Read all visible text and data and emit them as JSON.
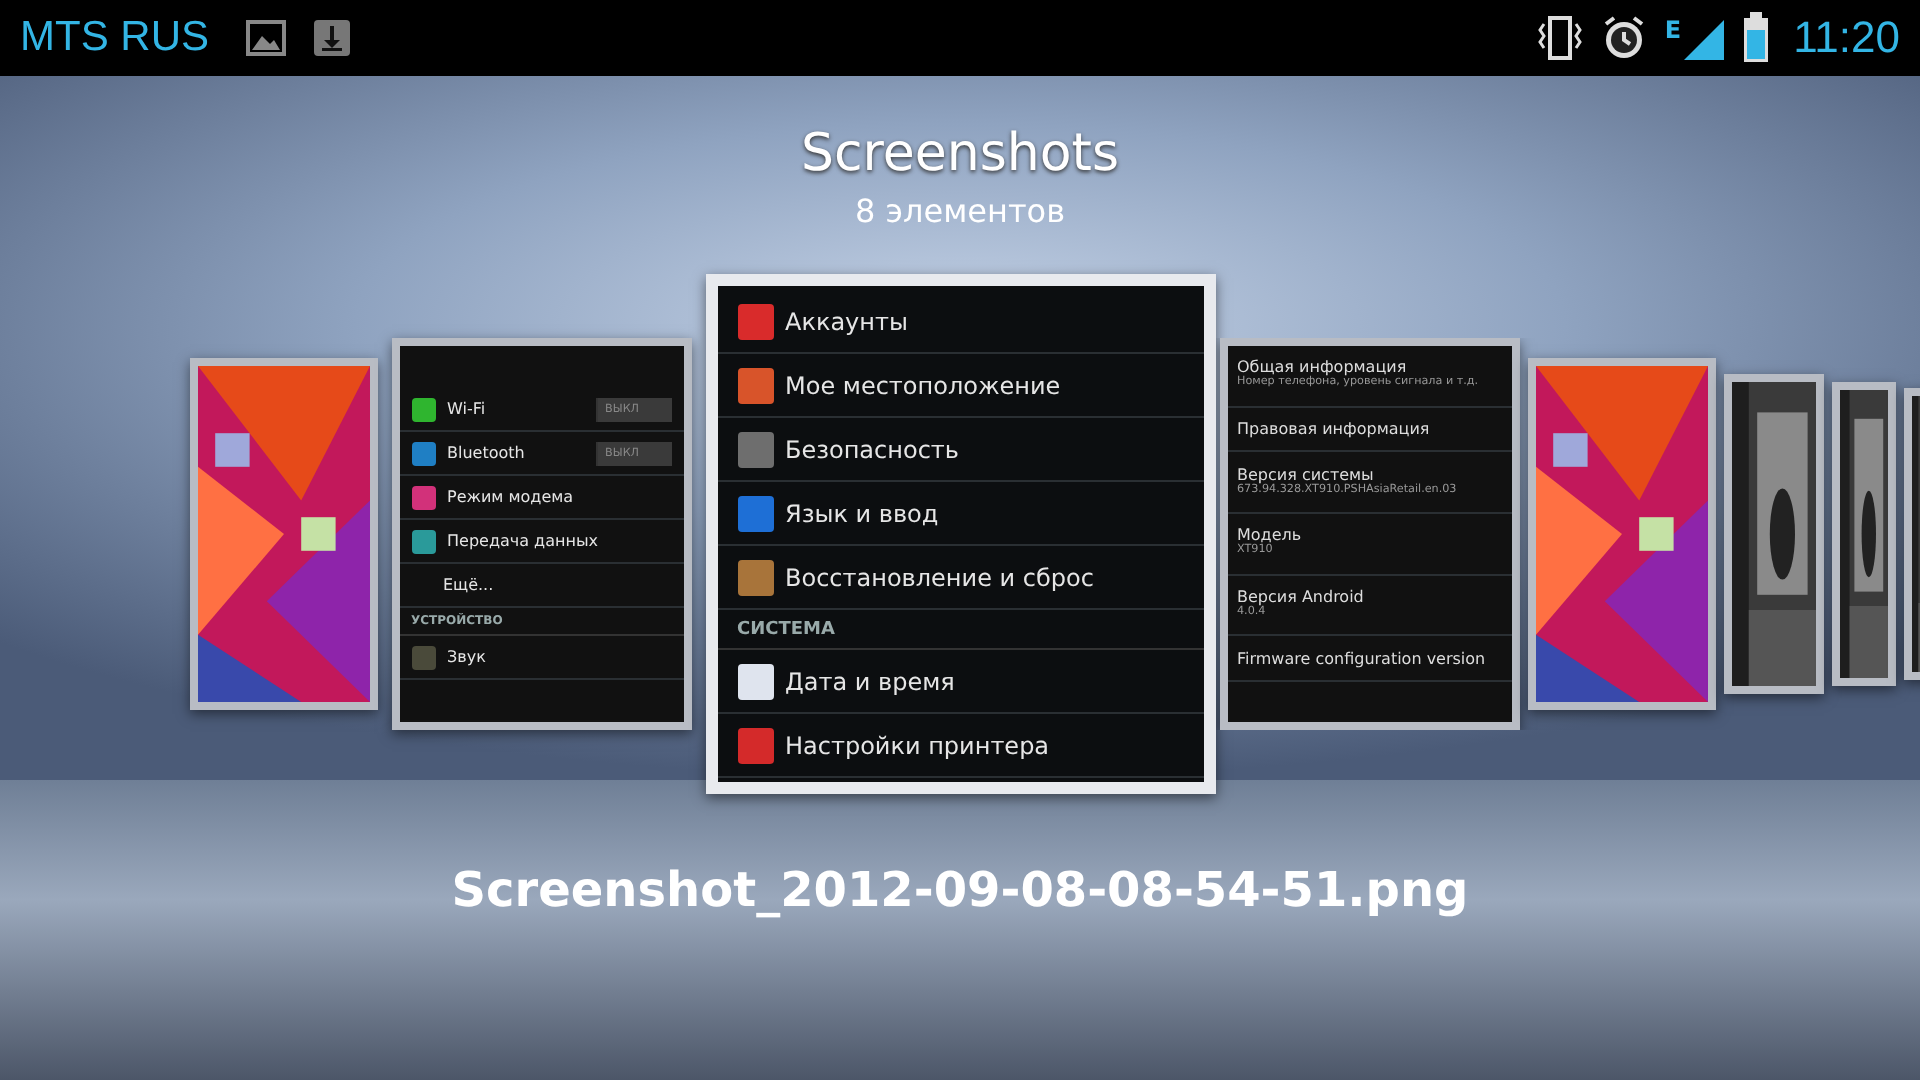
{
  "status_bar": {
    "carrier": "MTS RUS",
    "network_type": "E",
    "time": "11:20"
  },
  "album": {
    "title": "Screenshots",
    "count": "8 элементов"
  },
  "thumbnails": [
    {
      "kind": "picture",
      "selected": false
    },
    {
      "kind": "settings",
      "selected": false,
      "rows": [
        {
          "kind": "toggle",
          "label": "Wi-Fi",
          "value": "ВЫКЛ",
          "color": "#2fb52f"
        },
        {
          "kind": "toggle",
          "label": "Bluetooth",
          "value": "ВЫКЛ",
          "color": "#1f7fc4"
        },
        {
          "kind": "item",
          "label": "Режим модема",
          "color": "#d2317a"
        },
        {
          "kind": "item",
          "label": "Передача данных",
          "color": "#2a9a9a"
        },
        {
          "kind": "plain",
          "label": "Ещё..."
        },
        {
          "kind": "header",
          "label": "УСТРОЙСТВО"
        },
        {
          "kind": "item",
          "label": "Звук",
          "color": "#4a4a3a"
        }
      ]
    },
    {
      "kind": "settings",
      "selected": true,
      "rows": [
        {
          "kind": "item",
          "label": "Аккаунты",
          "color": "#d92b2b"
        },
        {
          "kind": "item",
          "label": "Мое местоположение",
          "color": "#d8542a"
        },
        {
          "kind": "item",
          "label": "Безопасность",
          "color": "#6e6e6e"
        },
        {
          "kind": "item",
          "label": "Язык и ввод",
          "color": "#1e6fd6"
        },
        {
          "kind": "item",
          "label": "Восстановление и сброс",
          "color": "#a8743a"
        },
        {
          "kind": "header",
          "label": "СИСТЕМА"
        },
        {
          "kind": "item",
          "label": "Дата и время",
          "color": "#dfe4ee"
        },
        {
          "kind": "item",
          "label": "Настройки принтера",
          "color": "#d42a2a"
        }
      ]
    },
    {
      "kind": "info",
      "selected": false,
      "rows": [
        {
          "title": "Общая информация",
          "subtitle": "Номер телефона, уровень сигнала и т.д."
        },
        {
          "title": "Правовая информация"
        },
        {
          "title": "Версия системы",
          "subtitle": "673.94.328.XT910.PSHAsiaRetail.en.03"
        },
        {
          "title": "Модель",
          "subtitle": "XT910"
        },
        {
          "title": "Версия Android",
          "subtitle": "4.0.4"
        },
        {
          "title": "Firmware configuration version"
        }
      ]
    },
    {
      "kind": "picture",
      "selected": false
    },
    {
      "kind": "picture",
      "selected": false
    },
    {
      "kind": "picture",
      "selected": false
    },
    {
      "kind": "picture",
      "selected": false
    }
  ],
  "filename": "Screenshot_2012-09-08-08-54-51.png"
}
